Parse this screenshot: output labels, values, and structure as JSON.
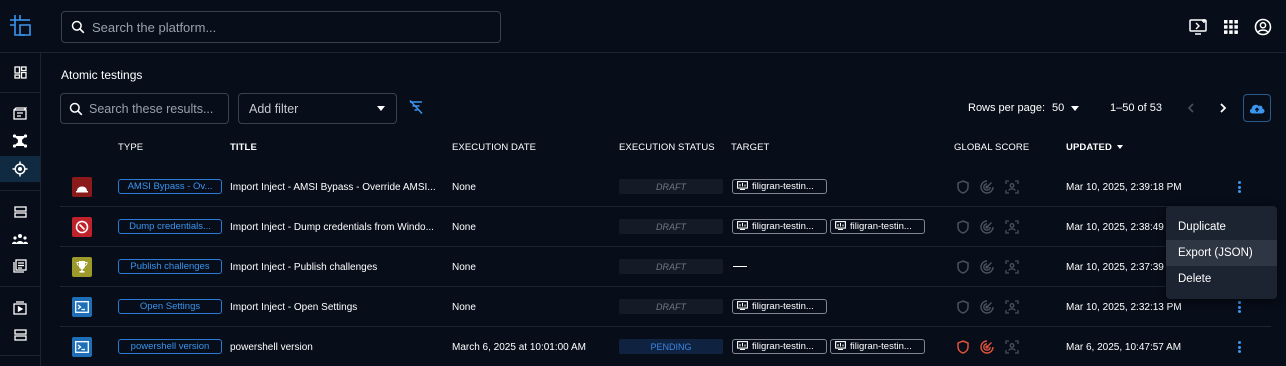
{
  "header": {
    "search_placeholder": "Search the platform..."
  },
  "page": {
    "title": "Atomic testings"
  },
  "toolbar": {
    "search_placeholder": "Search these results...",
    "add_filter_label": "Add filter",
    "rows_per_page_label": "Rows per page:",
    "rows_per_page_value": "50",
    "range_label": "1–50 of 53"
  },
  "table": {
    "headers": {
      "type": "TYPE",
      "title": "TITLE",
      "execution_date": "EXECUTION DATE",
      "execution_status": "EXECUTION STATUS",
      "target": "TARGET",
      "global_score": "GLOBAL SCORE",
      "updated": "UPDATED"
    },
    "rows": [
      {
        "type_icon": "siren-icon",
        "type_color": "#8b1a1a",
        "type": "AMSI Bypass - Ov...",
        "title": "Import Inject - AMSI Bypass - Override AMSI...",
        "execution_date": "None",
        "status": "DRAFT",
        "targets": [
          "filigran-testin..."
        ],
        "updated": "Mar 10, 2025, 2:39:18 PM"
      },
      {
        "type_icon": "no-entry-icon",
        "type_color": "#c0222b",
        "type": "Dump credentials...",
        "title": "Import Inject - Dump credentials from Windo...",
        "execution_date": "None",
        "status": "DRAFT",
        "targets": [
          "filigran-testin...",
          "filigran-testin..."
        ],
        "updated": "Mar 10, 2025, 2:38:49 PM"
      },
      {
        "type_icon": "trophy-icon",
        "type_color": "#9c9a2a",
        "type": "Publish challenges",
        "title": "Import Inject - Publish challenges",
        "execution_date": "None",
        "status": "DRAFT",
        "targets": [],
        "updated": "Mar 10, 2025, 2:37:39 PM"
      },
      {
        "type_icon": "terminal-icon",
        "type_color": "#1f6fb8",
        "type": "Open Settings",
        "title": "Import Inject - Open Settings",
        "execution_date": "None",
        "status": "DRAFT",
        "targets": [
          "filigran-testin..."
        ],
        "updated": "Mar 10, 2025, 2:32:13 PM"
      },
      {
        "type_icon": "terminal-icon",
        "type_color": "#1f6fb8",
        "type": "powershell version",
        "title": "powershell version",
        "execution_date": "March 6, 2025 at 10:01:00 AM",
        "status": "PENDING",
        "targets": [
          "filigran-testin...",
          "filigran-testin..."
        ],
        "updated": "Mar 6, 2025, 10:47:57 AM"
      }
    ]
  },
  "context_menu": {
    "items": [
      "Duplicate",
      "Export (JSON)",
      "Delete"
    ]
  },
  "colors": {
    "background": "#070d19",
    "accent": "#3b95ef",
    "score_failed": "#e2513a",
    "score_inactive": "#4a505c"
  }
}
